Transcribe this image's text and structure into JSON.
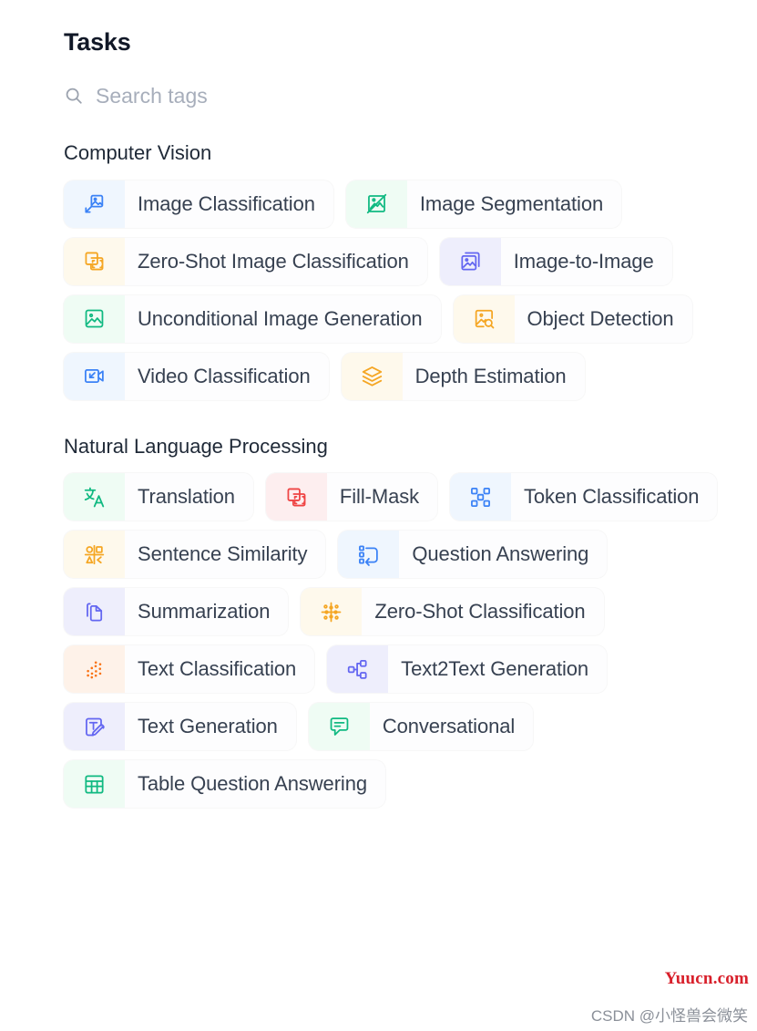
{
  "header": {
    "title": "Tasks"
  },
  "search": {
    "placeholder": "Search tags",
    "value": "",
    "icon": "search-icon"
  },
  "sections": [
    {
      "id": "computer-vision",
      "title": "Computer Vision",
      "tags": [
        {
          "label": "Image Classification",
          "icon": "image-arrow-icon",
          "color": "blue",
          "hex": "#3b82f6"
        },
        {
          "label": "Image Segmentation",
          "icon": "image-slash-icon",
          "color": "green",
          "hex": "#10b981"
        },
        {
          "label": "Zero-Shot Image Classification",
          "icon": "copy-frame-icon",
          "color": "amber",
          "hex": "#f5a623"
        },
        {
          "label": "Image-to-Image",
          "icon": "image-stack-icon",
          "color": "indigo",
          "hex": "#6366f1"
        },
        {
          "label": "Unconditional Image Generation",
          "icon": "image-icon",
          "color": "green",
          "hex": "#10b981"
        },
        {
          "label": "Object Detection",
          "icon": "image-search-icon",
          "color": "amber",
          "hex": "#f5a623"
        },
        {
          "label": "Video Classification",
          "icon": "video-arrow-icon",
          "color": "blue",
          "hex": "#3b82f6"
        },
        {
          "label": "Depth Estimation",
          "icon": "layers-icon",
          "color": "amber",
          "hex": "#f5a623"
        }
      ]
    },
    {
      "id": "natural-language-processing",
      "title": "Natural Language Processing",
      "tags": [
        {
          "label": "Translation",
          "icon": "translate-icon",
          "color": "green",
          "hex": "#10b981"
        },
        {
          "label": "Fill-Mask",
          "icon": "copy-frame-icon",
          "color": "red",
          "hex": "#ef4444"
        },
        {
          "label": "Token Classification",
          "icon": "nodes-grid-icon",
          "color": "blue",
          "hex": "#3b82f6"
        },
        {
          "label": "Sentence Similarity",
          "icon": "shapes-grid-icon",
          "color": "amber",
          "hex": "#f5a623"
        },
        {
          "label": "Question Answering",
          "icon": "list-reply-icon",
          "color": "blue",
          "hex": "#3b82f6"
        },
        {
          "label": "Summarization",
          "icon": "documents-icon",
          "color": "indigo",
          "hex": "#6366f1"
        },
        {
          "label": "Zero-Shot Classification",
          "icon": "scatter-cross-icon",
          "color": "amber",
          "hex": "#f5a623"
        },
        {
          "label": "Text Classification",
          "icon": "dots-cluster-icon",
          "color": "orange",
          "hex": "#f97316"
        },
        {
          "label": "Text2Text Generation",
          "icon": "flow-nodes-icon",
          "color": "indigo",
          "hex": "#6366f1"
        },
        {
          "label": "Text Generation",
          "icon": "text-pencil-icon",
          "color": "indigo",
          "hex": "#6366f1"
        },
        {
          "label": "Conversational",
          "icon": "chat-bubble-icon",
          "color": "green",
          "hex": "#10b981"
        },
        {
          "label": "Table Question Answering",
          "icon": "table-icon",
          "color": "green",
          "hex": "#10b981"
        }
      ]
    }
  ],
  "watermarks": {
    "red": "Yuucn.com",
    "gray": "CSDN @小怪兽会微笑"
  }
}
